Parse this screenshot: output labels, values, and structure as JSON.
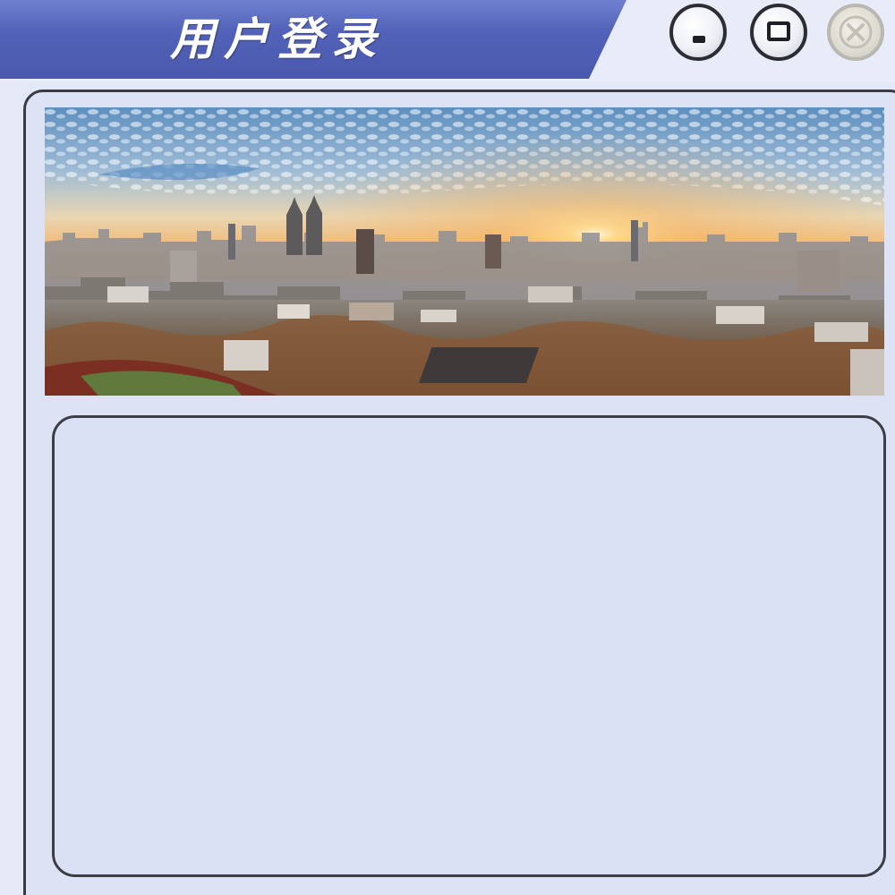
{
  "window": {
    "title": "用户登录",
    "controls": {
      "minimize": "minimize-icon",
      "maximize": "maximize-icon",
      "close": "close-icon"
    }
  },
  "banner": {
    "image": "city-skyline-sunset"
  },
  "colors": {
    "titlebar": "#5262b8",
    "panel": "#dde3f5",
    "border": "#3a3a44"
  }
}
